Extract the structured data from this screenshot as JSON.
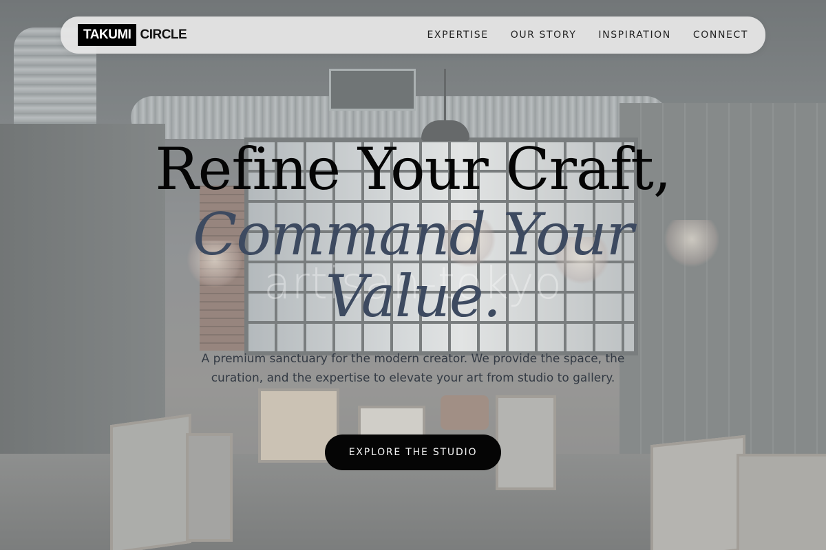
{
  "nav": {
    "logo_part1": "TAKUMI",
    "logo_part2": "CIRCLE",
    "links": [
      {
        "label": "EXPERTISE"
      },
      {
        "label": "OUR STORY"
      },
      {
        "label": "INSPIRATION"
      },
      {
        "label": "CONNECT"
      }
    ]
  },
  "hero": {
    "title_line1": "Refine Your Craft,",
    "title_line2": "Command Your Value.",
    "watermark": "artisan-tokyo",
    "subtitle": "A premium sanctuary for the modern creator. We provide the space, the curation, and the expertise to elevate your art from studio to gallery.",
    "cta_label": "EXPLORE THE STUDIO"
  },
  "colors": {
    "title_primary": "#050505",
    "title_accent": "#3d4a60",
    "button_bg": "#050505",
    "nav_bg": "#e6e6e6"
  }
}
